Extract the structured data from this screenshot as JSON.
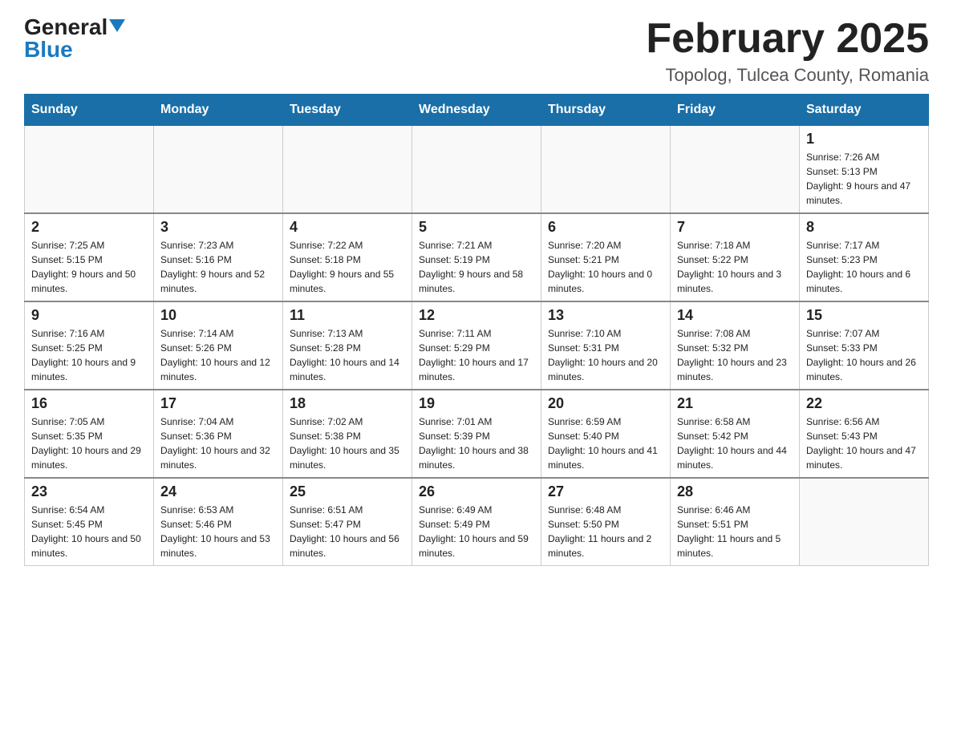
{
  "header": {
    "logo_general": "General",
    "logo_blue": "Blue",
    "month_title": "February 2025",
    "location": "Topolog, Tulcea County, Romania"
  },
  "days_of_week": [
    "Sunday",
    "Monday",
    "Tuesday",
    "Wednesday",
    "Thursday",
    "Friday",
    "Saturday"
  ],
  "weeks": [
    {
      "days": [
        {
          "date": "",
          "info": ""
        },
        {
          "date": "",
          "info": ""
        },
        {
          "date": "",
          "info": ""
        },
        {
          "date": "",
          "info": ""
        },
        {
          "date": "",
          "info": ""
        },
        {
          "date": "",
          "info": ""
        },
        {
          "date": "1",
          "info": "Sunrise: 7:26 AM\nSunset: 5:13 PM\nDaylight: 9 hours and 47 minutes."
        }
      ]
    },
    {
      "days": [
        {
          "date": "2",
          "info": "Sunrise: 7:25 AM\nSunset: 5:15 PM\nDaylight: 9 hours and 50 minutes."
        },
        {
          "date": "3",
          "info": "Sunrise: 7:23 AM\nSunset: 5:16 PM\nDaylight: 9 hours and 52 minutes."
        },
        {
          "date": "4",
          "info": "Sunrise: 7:22 AM\nSunset: 5:18 PM\nDaylight: 9 hours and 55 minutes."
        },
        {
          "date": "5",
          "info": "Sunrise: 7:21 AM\nSunset: 5:19 PM\nDaylight: 9 hours and 58 minutes."
        },
        {
          "date": "6",
          "info": "Sunrise: 7:20 AM\nSunset: 5:21 PM\nDaylight: 10 hours and 0 minutes."
        },
        {
          "date": "7",
          "info": "Sunrise: 7:18 AM\nSunset: 5:22 PM\nDaylight: 10 hours and 3 minutes."
        },
        {
          "date": "8",
          "info": "Sunrise: 7:17 AM\nSunset: 5:23 PM\nDaylight: 10 hours and 6 minutes."
        }
      ]
    },
    {
      "days": [
        {
          "date": "9",
          "info": "Sunrise: 7:16 AM\nSunset: 5:25 PM\nDaylight: 10 hours and 9 minutes."
        },
        {
          "date": "10",
          "info": "Sunrise: 7:14 AM\nSunset: 5:26 PM\nDaylight: 10 hours and 12 minutes."
        },
        {
          "date": "11",
          "info": "Sunrise: 7:13 AM\nSunset: 5:28 PM\nDaylight: 10 hours and 14 minutes."
        },
        {
          "date": "12",
          "info": "Sunrise: 7:11 AM\nSunset: 5:29 PM\nDaylight: 10 hours and 17 minutes."
        },
        {
          "date": "13",
          "info": "Sunrise: 7:10 AM\nSunset: 5:31 PM\nDaylight: 10 hours and 20 minutes."
        },
        {
          "date": "14",
          "info": "Sunrise: 7:08 AM\nSunset: 5:32 PM\nDaylight: 10 hours and 23 minutes."
        },
        {
          "date": "15",
          "info": "Sunrise: 7:07 AM\nSunset: 5:33 PM\nDaylight: 10 hours and 26 minutes."
        }
      ]
    },
    {
      "days": [
        {
          "date": "16",
          "info": "Sunrise: 7:05 AM\nSunset: 5:35 PM\nDaylight: 10 hours and 29 minutes."
        },
        {
          "date": "17",
          "info": "Sunrise: 7:04 AM\nSunset: 5:36 PM\nDaylight: 10 hours and 32 minutes."
        },
        {
          "date": "18",
          "info": "Sunrise: 7:02 AM\nSunset: 5:38 PM\nDaylight: 10 hours and 35 minutes."
        },
        {
          "date": "19",
          "info": "Sunrise: 7:01 AM\nSunset: 5:39 PM\nDaylight: 10 hours and 38 minutes."
        },
        {
          "date": "20",
          "info": "Sunrise: 6:59 AM\nSunset: 5:40 PM\nDaylight: 10 hours and 41 minutes."
        },
        {
          "date": "21",
          "info": "Sunrise: 6:58 AM\nSunset: 5:42 PM\nDaylight: 10 hours and 44 minutes."
        },
        {
          "date": "22",
          "info": "Sunrise: 6:56 AM\nSunset: 5:43 PM\nDaylight: 10 hours and 47 minutes."
        }
      ]
    },
    {
      "days": [
        {
          "date": "23",
          "info": "Sunrise: 6:54 AM\nSunset: 5:45 PM\nDaylight: 10 hours and 50 minutes."
        },
        {
          "date": "24",
          "info": "Sunrise: 6:53 AM\nSunset: 5:46 PM\nDaylight: 10 hours and 53 minutes."
        },
        {
          "date": "25",
          "info": "Sunrise: 6:51 AM\nSunset: 5:47 PM\nDaylight: 10 hours and 56 minutes."
        },
        {
          "date": "26",
          "info": "Sunrise: 6:49 AM\nSunset: 5:49 PM\nDaylight: 10 hours and 59 minutes."
        },
        {
          "date": "27",
          "info": "Sunrise: 6:48 AM\nSunset: 5:50 PM\nDaylight: 11 hours and 2 minutes."
        },
        {
          "date": "28",
          "info": "Sunrise: 6:46 AM\nSunset: 5:51 PM\nDaylight: 11 hours and 5 minutes."
        },
        {
          "date": "",
          "info": ""
        }
      ]
    }
  ]
}
